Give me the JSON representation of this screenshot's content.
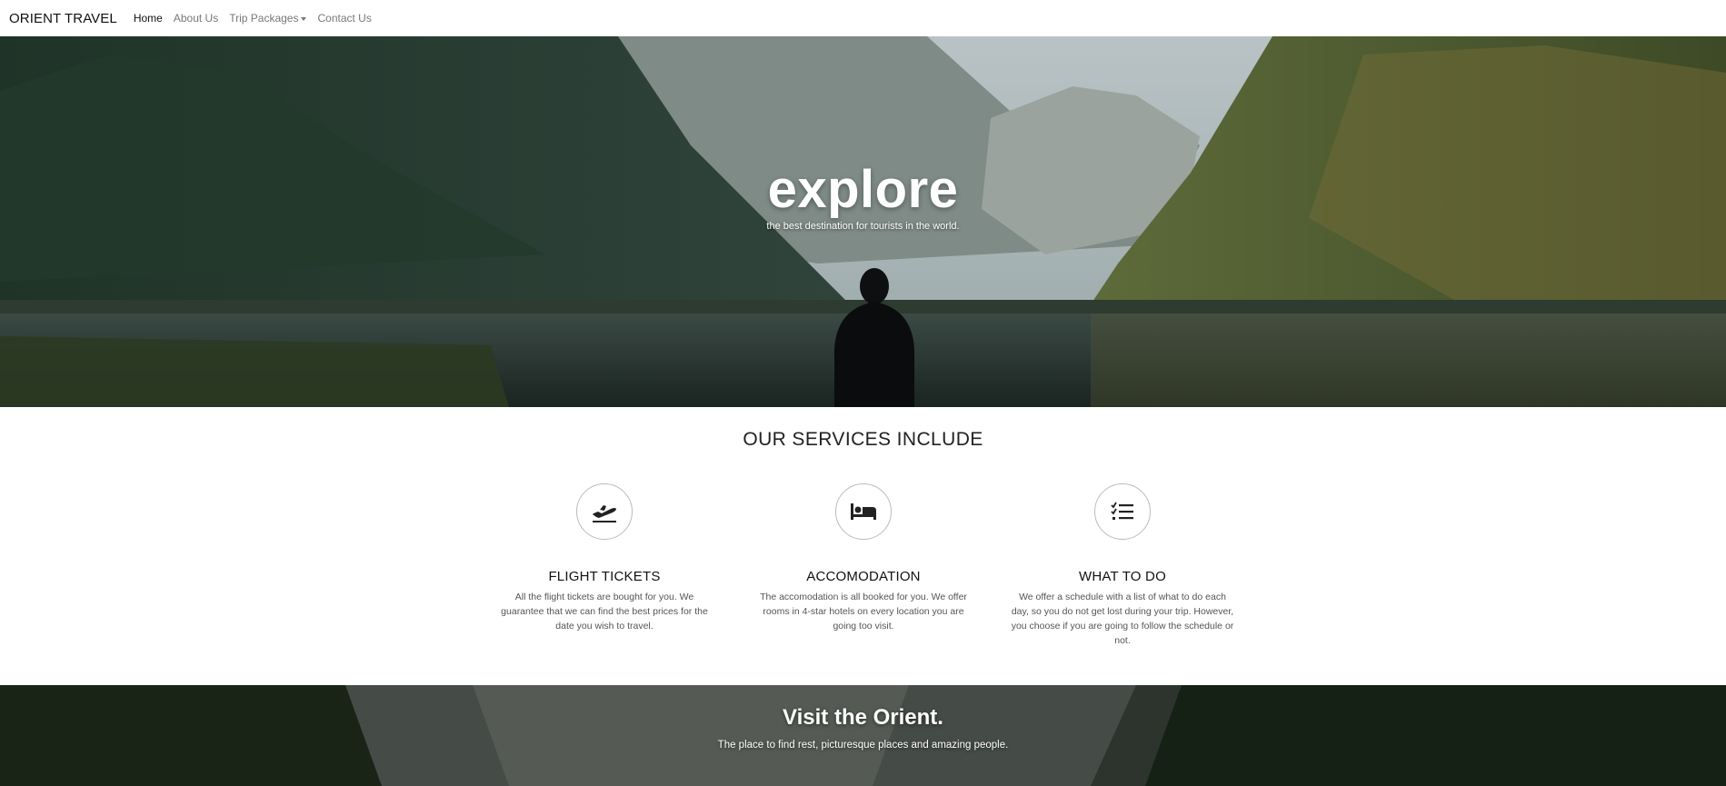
{
  "navbar": {
    "brand": "ORIENT TRAVEL",
    "links": [
      {
        "label": "Home",
        "active": true
      },
      {
        "label": "About Us",
        "active": false
      },
      {
        "label": "Trip Packages",
        "active": false,
        "dropdown": true
      },
      {
        "label": "Contact Us",
        "active": false
      }
    ]
  },
  "hero": {
    "title": "explore",
    "subtitle": "the best destination for tourists in the world."
  },
  "services": {
    "heading": "OUR SERVICES INCLUDE",
    "items": [
      {
        "icon": "plane-departure-icon",
        "title": "FLIGHT TICKETS",
        "text": "All the flight tickets are bought for you. We guarantee that we can find the best prices for the date you wish to travel."
      },
      {
        "icon": "bed-icon",
        "title": "ACCOMODATION",
        "text": "The accomodation is all booked for you. We offer rooms in 4-star hotels on every location you are going too visit."
      },
      {
        "icon": "checklist-icon",
        "title": "WHAT TO DO",
        "text": "We offer a schedule with a list of what to do each day, so you do not get lost during your trip. However, you choose if you are going to follow the schedule or not."
      }
    ]
  },
  "banner": {
    "title": "Visit the Orient.",
    "subtitle": "The place to find rest, picturesque places and amazing people."
  },
  "colors": {
    "navbar_bg": "#ffffff",
    "text_dark": "#111111",
    "nav_muted": "#777777",
    "circle_border": "#bbbbbb"
  }
}
